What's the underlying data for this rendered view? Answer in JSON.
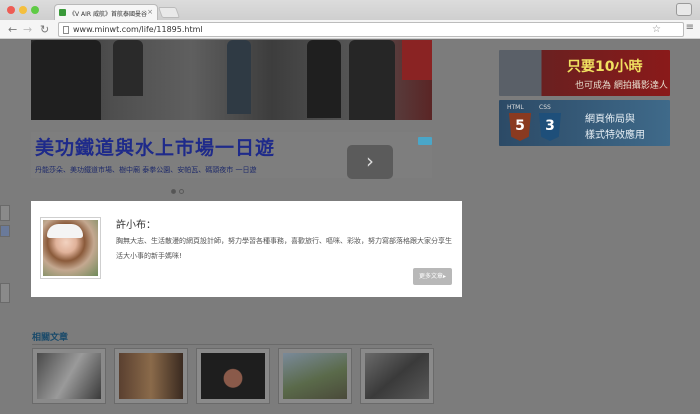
{
  "browser": {
    "tab_title": "《V AIR 威航》首航泰國曼谷",
    "url": "www.minwt.com/life/11895.html"
  },
  "ad": {
    "title": "美功鐵道與水上市場一日遊",
    "subtitle": "丹能莎朵、美功鐵道市場、樹中廟 泰拳公園、安帕瓦、碼頭夜市 一日遊",
    "arrow": "›"
  },
  "side_banners": {
    "banner1": {
      "big": "只要10小時",
      "small": "也可成為 網拍攝影達人"
    },
    "banner2": {
      "html_label": "HTML",
      "css_label": "CSS",
      "html_num": "5",
      "css_num": "3",
      "line1": "網頁佈局與",
      "line2": "樣式特效應用"
    }
  },
  "author": {
    "name": "許小布：",
    "bio": "胸無大志、生活散漫的網頁設計師，努力學習各種事務，喜歡旅行、嘔咪、彩妝，努力寫部落格跟大家分享生活大小事的新手媽咪!",
    "more_label": "更多文章▸"
  },
  "related": {
    "title": "相關文章"
  }
}
